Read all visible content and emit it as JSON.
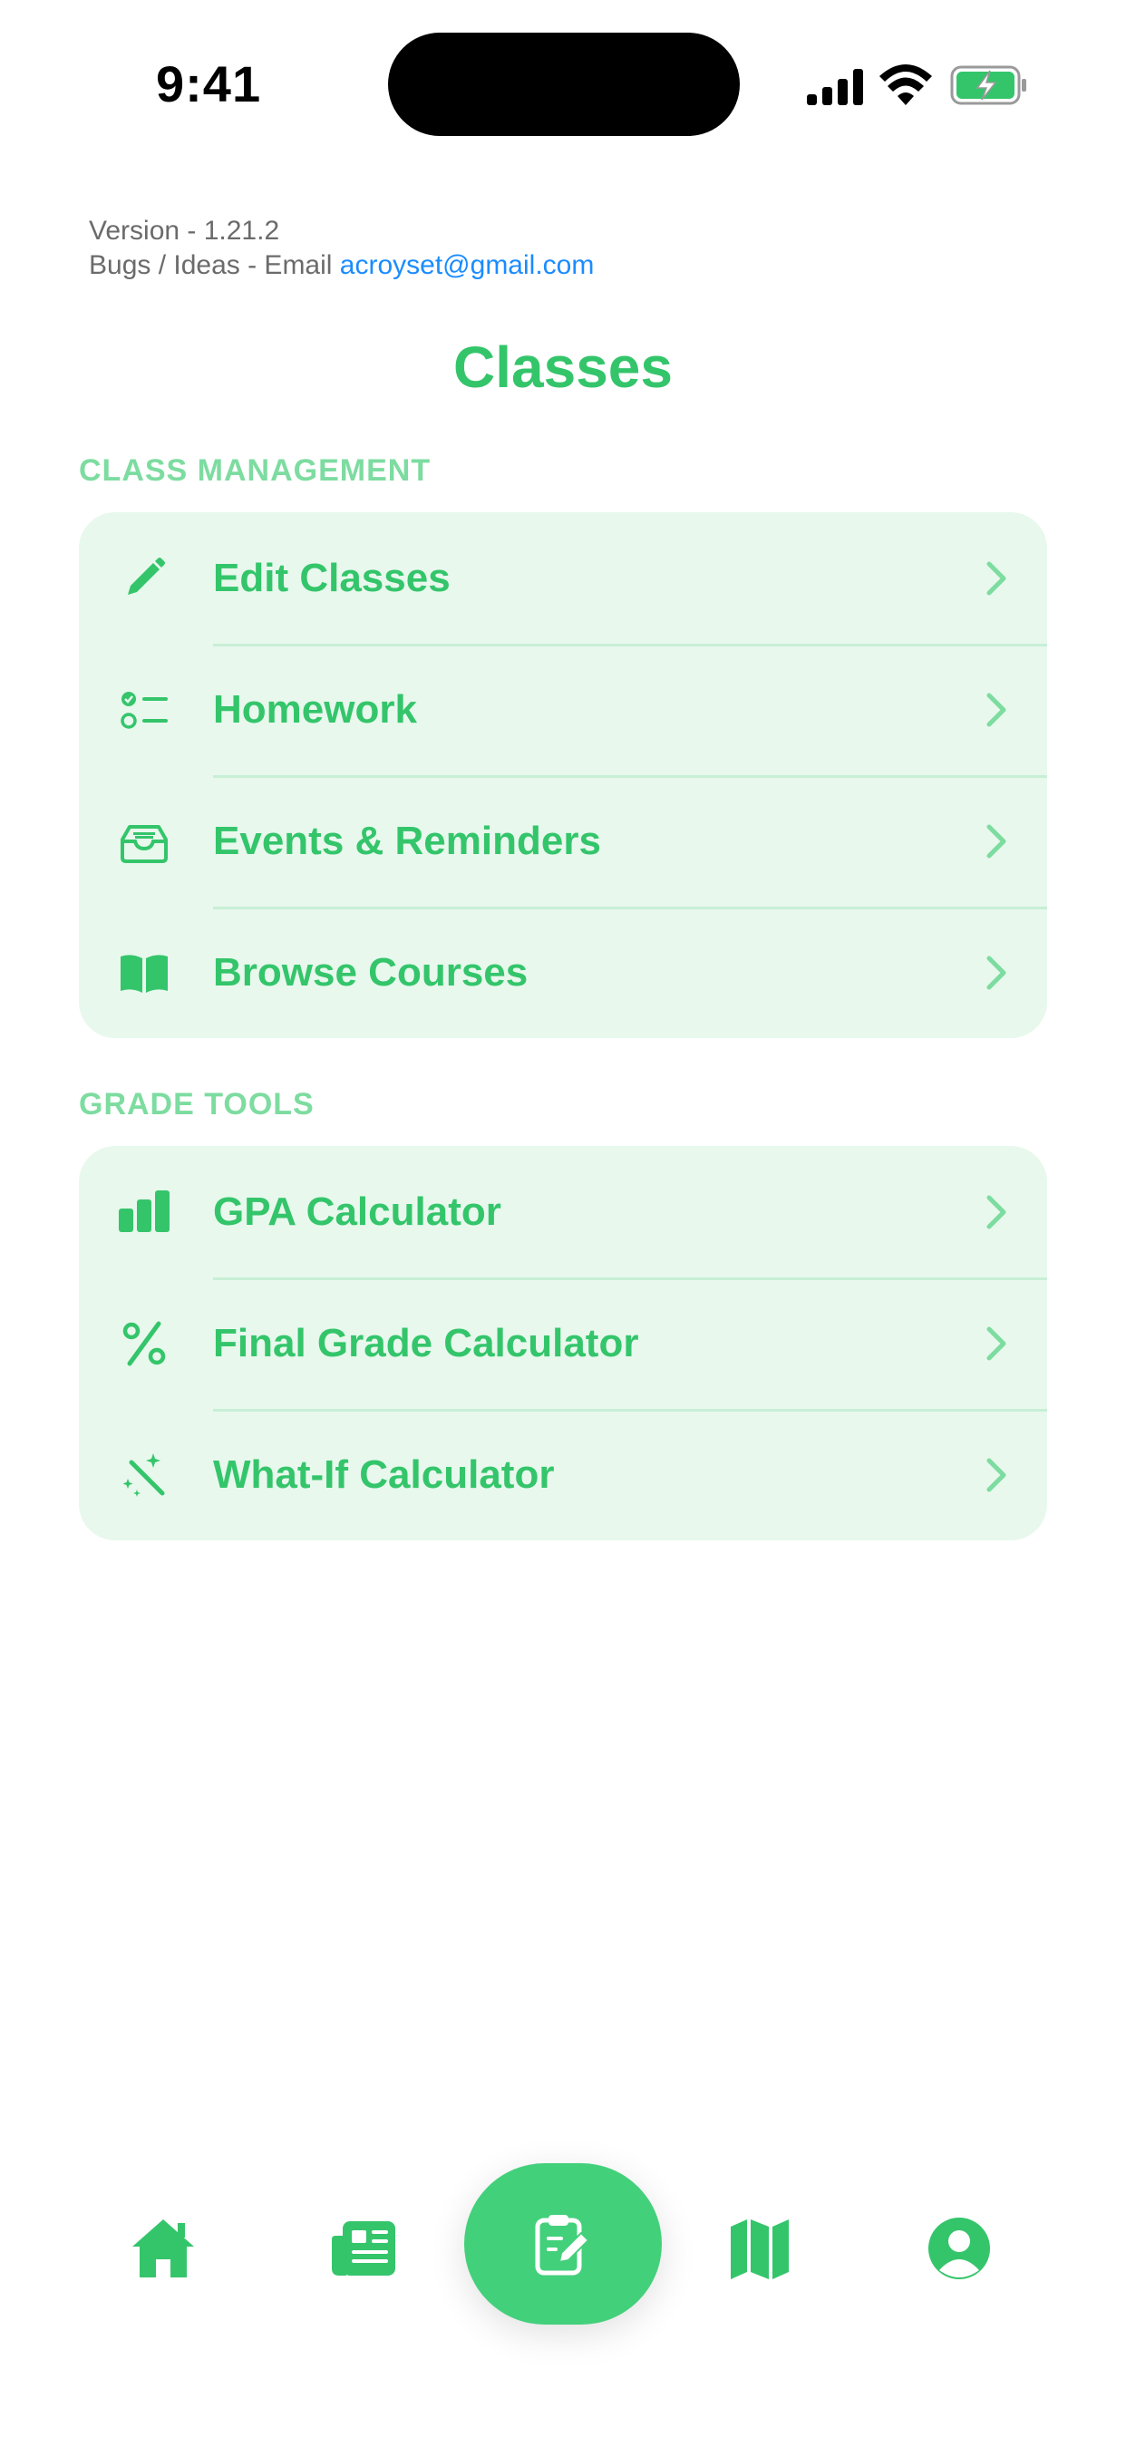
{
  "status_bar": {
    "time": "9:41"
  },
  "info": {
    "version": "Version - 1.21.2",
    "bugs_prefix": "Bugs / Ideas - Email ",
    "email": "acroyset@gmail.com"
  },
  "page_title": "Classes",
  "sections": {
    "class_management": {
      "header": "CLASS MANAGEMENT",
      "items": [
        {
          "label": "Edit Classes",
          "icon": "pencil-icon"
        },
        {
          "label": "Homework",
          "icon": "checklist-icon"
        },
        {
          "label": "Events & Reminders",
          "icon": "tray-icon"
        },
        {
          "label": "Browse Courses",
          "icon": "book-icon"
        }
      ]
    },
    "grade_tools": {
      "header": "GRADE TOOLS",
      "items": [
        {
          "label": "GPA Calculator",
          "icon": "bar-chart-icon"
        },
        {
          "label": "Final Grade Calculator",
          "icon": "percent-icon"
        },
        {
          "label": "What-If Calculator",
          "icon": "magic-wand-icon"
        }
      ]
    }
  },
  "tab_bar": {
    "items": [
      "home-icon",
      "newspaper-icon",
      "clipboard-edit-icon",
      "map-icon",
      "profile-icon"
    ],
    "active": "clipboard-edit-icon"
  },
  "colors": {
    "accent": "#34C56B",
    "row_background": "#e8f8ed",
    "section_header": "#7ddca0",
    "link": "#1a8cff",
    "center_button": "#43d07b"
  }
}
